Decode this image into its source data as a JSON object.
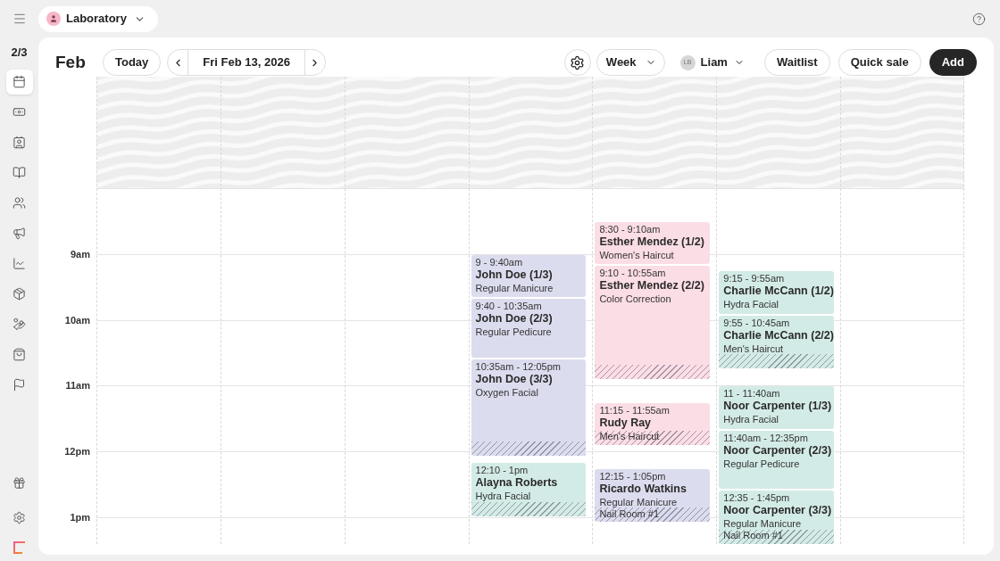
{
  "topbar": {
    "location": "Laboratory"
  },
  "sidebar": {
    "counter": "2/3",
    "items": [
      {
        "selected": true
      },
      {
        "selected": false
      },
      {
        "selected": false
      },
      {
        "selected": false
      },
      {
        "selected": false
      },
      {
        "selected": false
      },
      {
        "selected": false
      },
      {
        "selected": false
      },
      {
        "selected": false
      },
      {
        "selected": false
      },
      {
        "selected": false
      }
    ],
    "footer_items": [
      {
        "selected": false
      },
      {
        "selected": false
      }
    ]
  },
  "header": {
    "month": "Feb",
    "today": "Today",
    "date": "Fri Feb 13, 2026",
    "view": "Week",
    "staff_initials": "LB",
    "staff": "Liam",
    "buttons": [
      "Waitlist",
      "Quick sale"
    ],
    "primary": "Add"
  },
  "hours": [
    {
      "label": "9am"
    },
    {
      "label": "10am"
    },
    {
      "label": "11am"
    },
    {
      "label": "12pm"
    },
    {
      "label": "1pm"
    }
  ],
  "days": [
    {
      "events": [
        {
          "time": "9 - 9:40am",
          "name": "John Doe (1/3)",
          "service": "Regular Manicure",
          "color": "#dcdcef",
          "hatched": false
        },
        {
          "time": "9:40 - 10:35am",
          "name": "John Doe (2/3)",
          "service": "Regular Pedicure",
          "color": "#dcdcef",
          "hatched": false
        },
        {
          "time": "10:35am - 12:05pm",
          "name": "John Doe (3/3)",
          "service": "Oxygen Facial",
          "color": "#dcdcef",
          "hatched": true
        },
        {
          "time": "12:10 - 1pm",
          "name": "Alayna Roberts",
          "service": "Hydra Facial",
          "color": "#d3ebe6",
          "hatched": true
        }
      ]
    },
    {
      "events": [
        {
          "time": "8:30 - 9:10am",
          "name": "Esther Mendez (1/2)",
          "service": "Women's Haircut",
          "color": "#fbdde5",
          "hatched": false
        },
        {
          "time": "9:10 - 10:55am",
          "name": "Esther Mendez (2/2)",
          "service": "Color Correction",
          "color": "#fbdde5",
          "hatched": true
        },
        {
          "time": "11:15 - 11:55am",
          "name": "Rudy Ray",
          "service": "Men's Haircut",
          "color": "#fbdde5",
          "hatched": true
        },
        {
          "time": "12:15 - 1:05pm",
          "name": "Ricardo Watkins",
          "service": "Regular Manicure",
          "room": "Nail Room #1",
          "color": "#dcdcef",
          "hatched": true
        }
      ]
    },
    {
      "events": [
        {
          "time": "9:15 - 9:55am",
          "name": "Charlie McCann (1/2)",
          "service": "Hydra Facial",
          "color": "#d3ebe6",
          "hatched": false
        },
        {
          "time": "9:55 - 10:45am",
          "name": "Charlie McCann (2/2)",
          "service": "Men's Haircut",
          "color": "#d3ebe6",
          "hatched": true
        },
        {
          "time": "11 - 11:40am",
          "name": "Noor Carpenter (1/3)",
          "service": "Hydra Facial",
          "color": "#d3ebe6",
          "hatched": false
        },
        {
          "time": "11:40am - 12:35pm",
          "name": "Noor Carpenter (2/3)",
          "service": "Regular Pedicure",
          "color": "#d3ebe6",
          "hatched": false
        },
        {
          "time": "12:35 - 1:45pm",
          "name": "Noor Carpenter (3/3)",
          "service": "Regular Manicure",
          "room": "Nail Room #1",
          "color": "#d3ebe6",
          "hatched": true
        }
      ]
    }
  ]
}
